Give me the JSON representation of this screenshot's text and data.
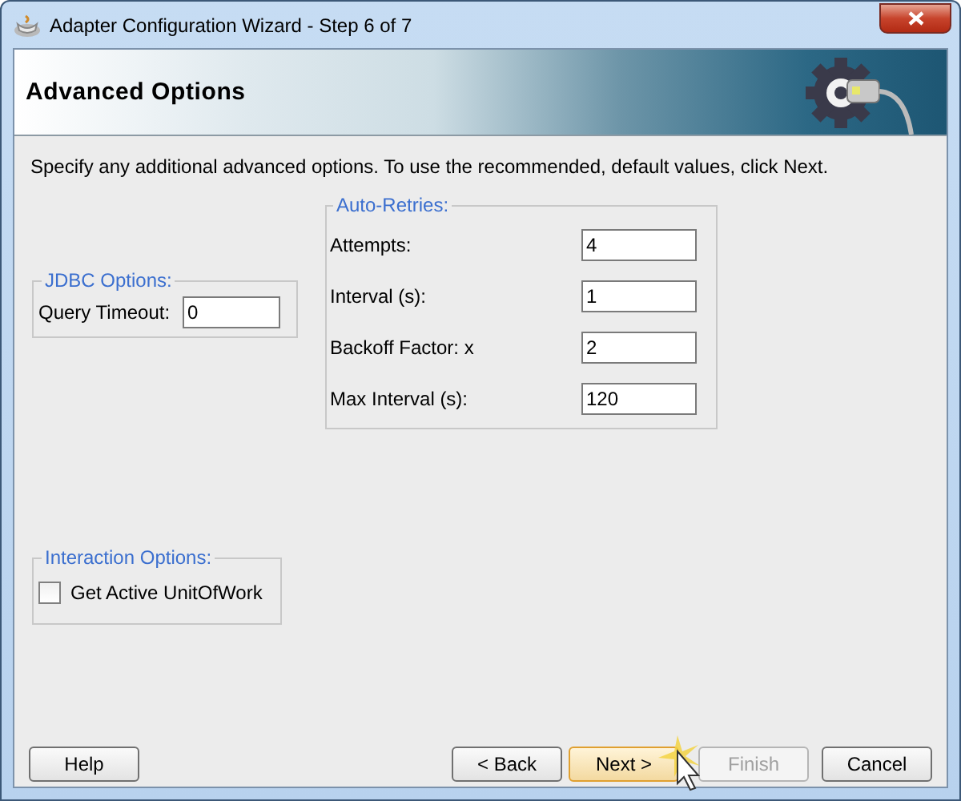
{
  "window": {
    "title": "Adapter Configuration Wizard - Step 6 of 7"
  },
  "header": {
    "title": "Advanced Options"
  },
  "description": "Specify any additional advanced options.  To use the recommended, default values, click Next.",
  "jdbc_options": {
    "title": "JDBC Options:",
    "items": [
      {
        "kind": "field",
        "label": "Query Timeout:",
        "value": "0"
      }
    ]
  },
  "auto_retries": {
    "title": "Auto-Retries:",
    "items": [
      {
        "kind": "field",
        "label": "Attempts:",
        "value": "4"
      },
      {
        "kind": "field",
        "label": "Interval (s):",
        "value": "1"
      },
      {
        "kind": "field",
        "label": "Backoff Factor: x",
        "value": "2"
      },
      {
        "kind": "field",
        "label": "Max Interval (s):",
        "value": "120"
      }
    ]
  },
  "interaction_options": {
    "title": "Interaction Options:",
    "items": [
      {
        "kind": "checkbox",
        "label": "Get Active UnitOfWork",
        "checked": false
      }
    ]
  },
  "buttons": [
    {
      "label": "Help",
      "disabled": false,
      "focused": false
    },
    {
      "label": "< Back",
      "disabled": false,
      "focused": false
    },
    {
      "label": "Next >",
      "disabled": false,
      "focused": true
    },
    {
      "label": "Finish",
      "disabled": true,
      "focused": false
    },
    {
      "label": "Cancel",
      "disabled": false,
      "focused": false
    }
  ]
}
